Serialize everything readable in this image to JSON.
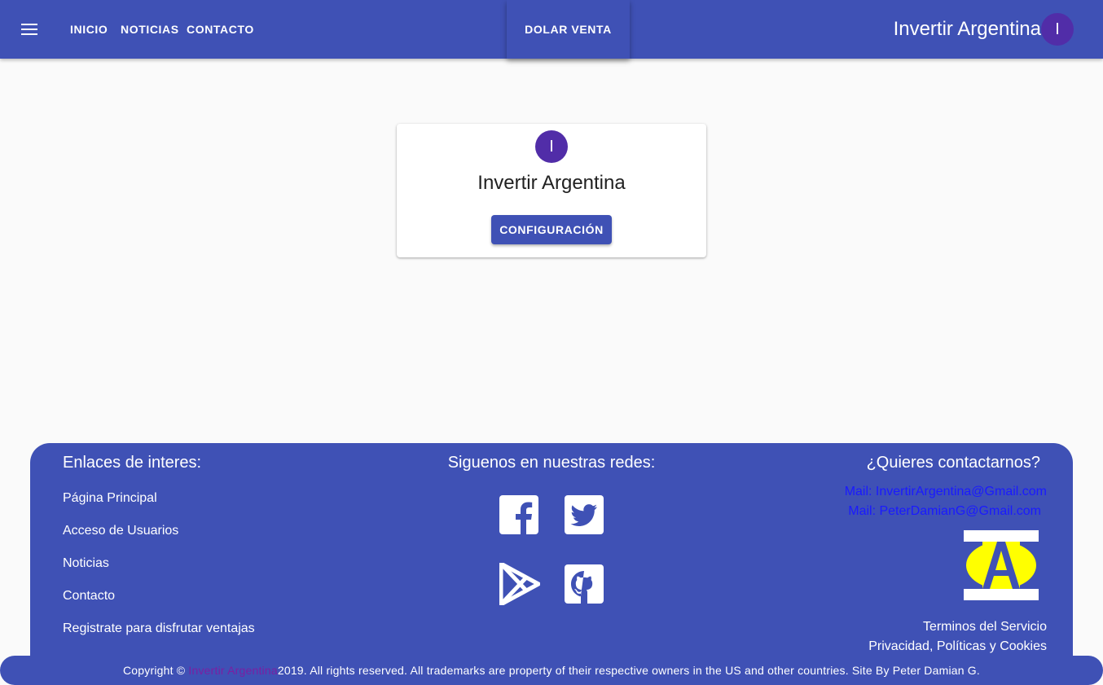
{
  "header": {
    "nav": [
      "INICIO",
      "NOTICIAS",
      "CONTACTO"
    ],
    "dolar_button": "DOLAR VENTA",
    "brand": "Invertir Argentina",
    "avatar_letter": "I"
  },
  "profile": {
    "avatar_letter": "I",
    "name": "Invertir Argentina",
    "config_button": "CONFIGURACIÓN"
  },
  "footer": {
    "links_heading": "Enlaces de interes:",
    "links": [
      "Página Principal",
      "Acceso de Usuarios",
      "Noticias",
      "Contacto",
      "Registrate para disfrutar ventajas"
    ],
    "social_heading": "Siguenos en nuestras redes:",
    "social_icons": [
      "facebook-icon",
      "twitter-icon",
      "google-play-icon",
      "github-icon"
    ],
    "contact_heading": "¿Quieres contactarnos?",
    "mails": [
      "Mail: InvertirArgentina@Gmail.com",
      "Mail: PeterDamianG@Gmail.com"
    ],
    "legal": [
      "Terminos del Servicio",
      "Privacidad, Políticas y Cookies"
    ]
  },
  "copyright": {
    "prefix": "Copyright © ",
    "brand": "Invertir Argentina",
    "suffix": " 2019. All rights reserved. All trademarks are property of their respective owners in the US and other countries. Site By Peter Damian G."
  },
  "colors": {
    "primary": "#3f51b5",
    "avatar": "#512da8",
    "mail_link": "#1a1aff",
    "brand_link": "#7b1fa2",
    "logo_yellow": "#ffff00"
  }
}
